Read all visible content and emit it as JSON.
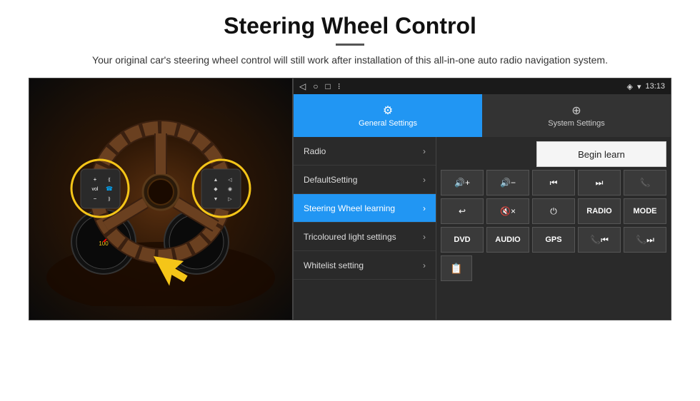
{
  "page": {
    "title": "Steering Wheel Control",
    "subtitle": "Your original car's steering wheel control will still work after installation of this all-in-one auto radio navigation system.",
    "divider": true
  },
  "status_bar": {
    "nav_back": "◁",
    "nav_home": "○",
    "nav_recent": "□",
    "nav_menu": "⁝",
    "signal_icon": "◆",
    "wifi_icon": "▾",
    "time": "13:13"
  },
  "tabs": {
    "general": {
      "label": "General Settings",
      "icon": "⚙",
      "active": true
    },
    "system": {
      "label": "System Settings",
      "icon": "⊕",
      "active": false
    }
  },
  "menu": {
    "items": [
      {
        "label": "Radio",
        "active": false
      },
      {
        "label": "DefaultSetting",
        "active": false
      },
      {
        "label": "Steering Wheel learning",
        "active": true
      },
      {
        "label": "Tricoloured light settings",
        "active": false
      },
      {
        "label": "Whitelist setting",
        "active": false
      }
    ]
  },
  "controls": {
    "begin_learn_label": "Begin learn",
    "row1": [
      {
        "type": "icon",
        "content": "🔊+"
      },
      {
        "type": "icon",
        "content": "🔊−"
      },
      {
        "type": "icon",
        "content": "|◀◀"
      },
      {
        "type": "icon",
        "content": "▶▶|"
      },
      {
        "type": "icon",
        "content": "📞"
      }
    ],
    "row2": [
      {
        "type": "icon",
        "content": "↩"
      },
      {
        "type": "icon",
        "content": "🔇×"
      },
      {
        "type": "icon",
        "content": "⏻"
      },
      {
        "type": "label",
        "content": "RADIO"
      },
      {
        "type": "label",
        "content": "MODE"
      }
    ],
    "row3": [
      {
        "type": "label",
        "content": "DVD"
      },
      {
        "type": "label",
        "content": "AUDIO"
      },
      {
        "type": "label",
        "content": "GPS"
      },
      {
        "type": "icon",
        "content": "📞|◀◀"
      },
      {
        "type": "icon",
        "content": "📞▶▶"
      }
    ],
    "row4": [
      {
        "type": "icon",
        "content": "📋"
      }
    ]
  }
}
